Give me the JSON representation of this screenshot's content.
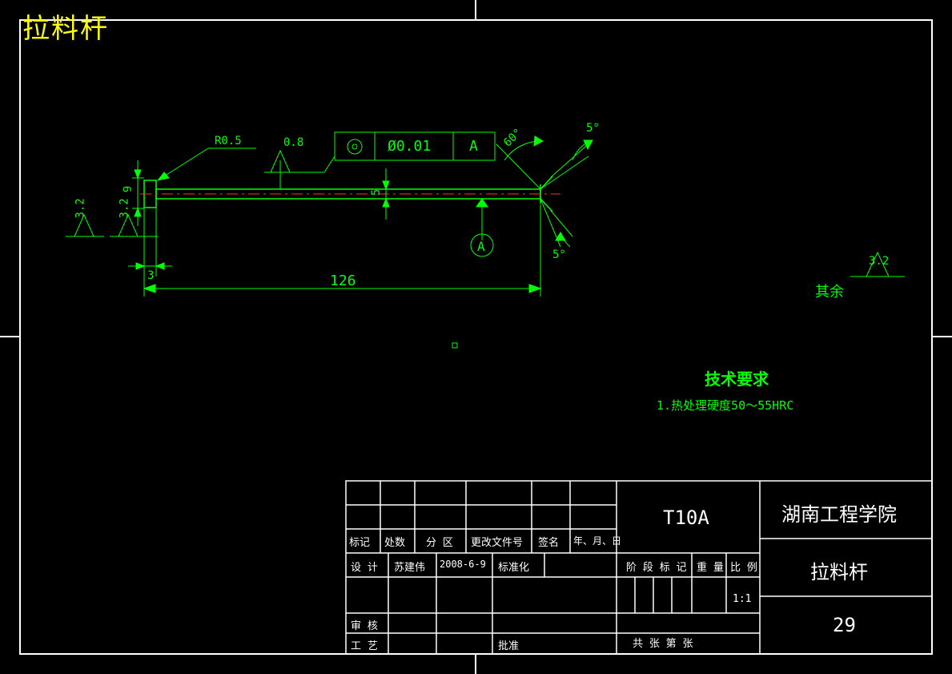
{
  "title": "拉料杆",
  "dims": {
    "r_label": "R0.5",
    "s08": "0.8",
    "s32a": "3.2",
    "s32b": "3.2",
    "d9": "9",
    "d3": "3",
    "d5": "5",
    "len126": "126",
    "ang60": "60°",
    "ang5a": "5°",
    "ang5b": "5°",
    "tol": "Ø0.01",
    "datum": "A",
    "datumA2": "A",
    "surf_other_val": "3.2",
    "surf_other": "其余"
  },
  "tech": {
    "head": "技术要求",
    "l1": "1.热处理硬度50～55HRC"
  },
  "tb": {
    "mark": "标记",
    "cnt": "处数",
    "zone": "分 区",
    "docno": "更改文件号",
    "sign": "签名",
    "date": "年、月、日",
    "design": "设 计",
    "designer": "苏建伟",
    "designdate": "2008-6-9",
    "std": "标准化",
    "review": "审 核",
    "process": "工 艺",
    "approve": "批准",
    "stage": "阶 段 标 记",
    "weight": "重 量",
    "scale": "比 例",
    "scaleval": "1:1",
    "sheets": "共      张  第      张",
    "material": "T10A",
    "school": "湖南工程学院",
    "partname": "拉料杆",
    "partno": "29"
  }
}
